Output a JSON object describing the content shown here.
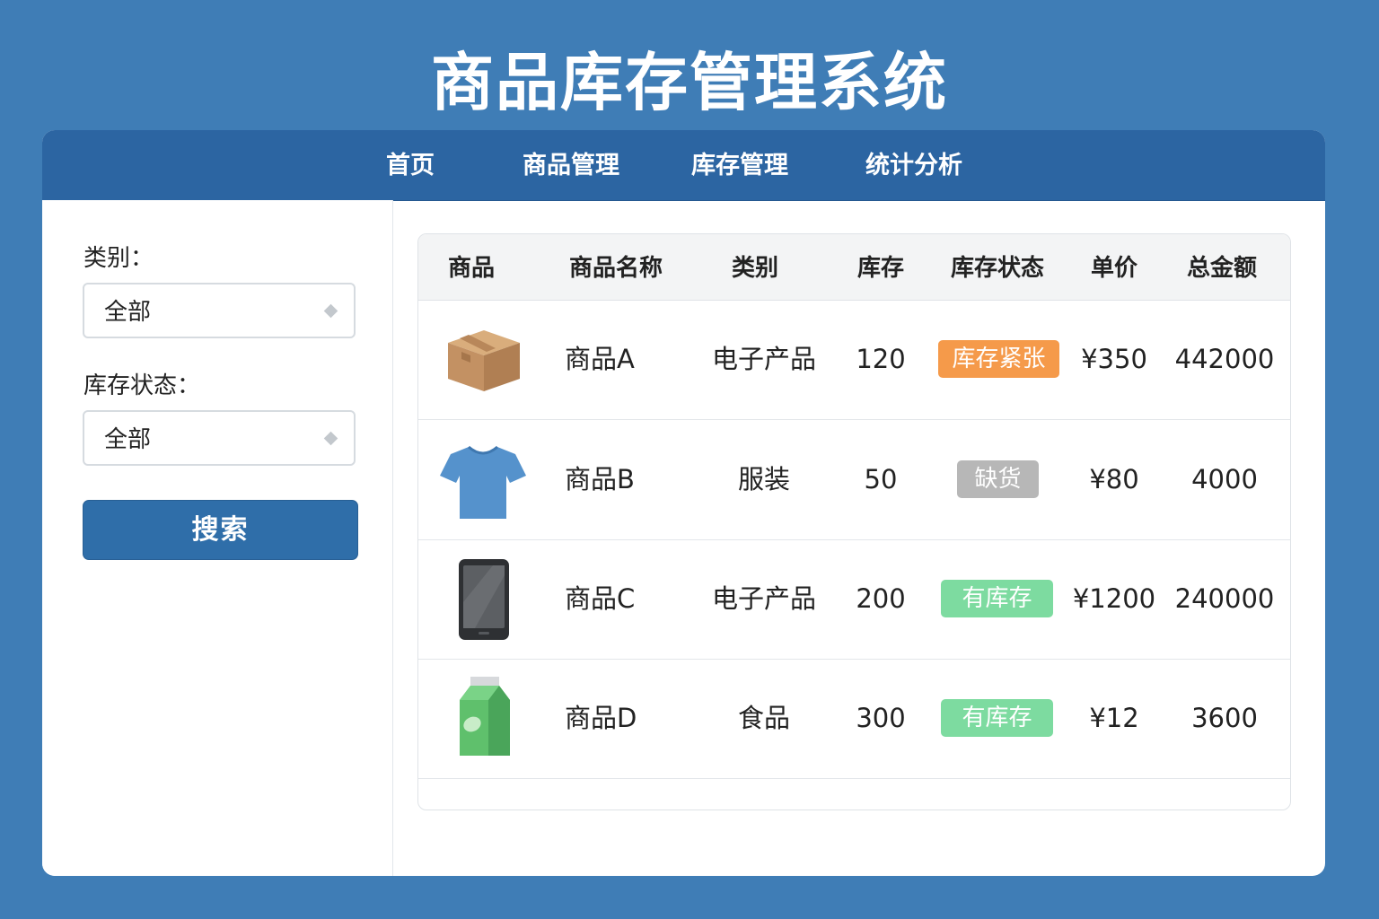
{
  "app": {
    "title": "商品库存管理系统"
  },
  "nav": {
    "items": [
      {
        "label": "首页"
      },
      {
        "label": "商品管理"
      },
      {
        "label": "库存管理"
      },
      {
        "label": "统计分析"
      }
    ]
  },
  "filters": {
    "category": {
      "label": "类别：",
      "value": "全部"
    },
    "stock_status": {
      "label": "库存状态：",
      "value": "全部"
    },
    "search_button": "搜索"
  },
  "table": {
    "headers": [
      "商品",
      "商品名称",
      "类别",
      "库存",
      "库存状态",
      "单价",
      "总金额"
    ],
    "rows": [
      {
        "icon": "cardboard-box-icon",
        "name": "商品A",
        "category": "电子产品",
        "stock": "120",
        "status": "库存紧张",
        "status_color": "#f59a4a",
        "price": "¥350",
        "total": "442000"
      },
      {
        "icon": "tshirt-icon",
        "name": "商品B",
        "category": "服装",
        "stock": "50",
        "status": "缺货",
        "status_color": "#b7b7b7",
        "price": "¥80",
        "total": "4000"
      },
      {
        "icon": "smartphone-icon",
        "name": "商品C",
        "category": "电子产品",
        "stock": "200",
        "status": "有库存",
        "status_color": "#7ddba0",
        "price": "¥1200",
        "total": "240000"
      },
      {
        "icon": "milk-carton-icon",
        "name": "商品D",
        "category": "食品",
        "stock": "300",
        "status": "有库存",
        "status_color": "#7ddba0",
        "price": "¥12",
        "total": "3600"
      }
    ]
  },
  "colors": {
    "background": "#3f7db6",
    "navbar": "#2c65a2",
    "primary_button": "#2f6ea9"
  }
}
